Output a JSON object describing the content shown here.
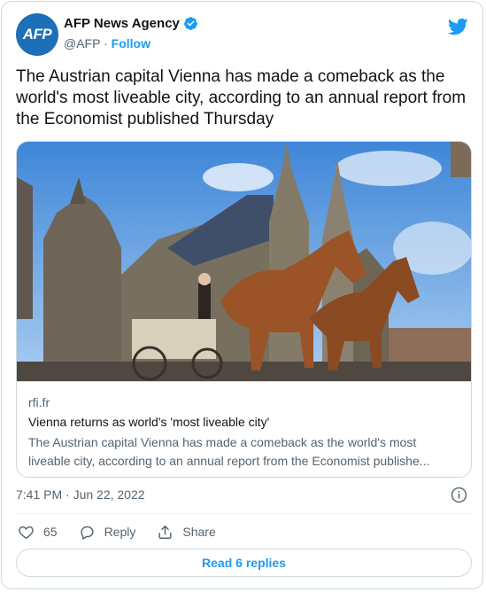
{
  "account": {
    "avatar_text": "AFP",
    "name": "AFP News Agency",
    "handle": "@AFP",
    "separator": "·",
    "follow_label": "Follow"
  },
  "tweet": {
    "text": "The Austrian capital Vienna has made a comeback as the world's most liveable city, according to an annual report from the Economist published Thursday",
    "timestamp": "7:41 PM · Jun 22, 2022"
  },
  "link_card": {
    "domain": "rfi.fr",
    "title": "Vienna returns as world's 'most liveable city'",
    "description": "The Austrian capital Vienna has made a comeback as the world's most liveable city, according to an annual report from the Economist publishe..."
  },
  "actions": {
    "like_count": "65",
    "reply_label": "Reply",
    "share_label": "Share"
  },
  "read_replies_label": "Read 6 replies",
  "colors": {
    "accent": "#1d9bf0",
    "avatar_bg": "#1d6fb8",
    "secondary_text": "#536471",
    "border": "#cfd9de"
  },
  "icons": [
    "verified-badge-icon",
    "twitter-bird-icon",
    "info-icon",
    "heart-icon",
    "reply-bubble-icon",
    "share-icon"
  ]
}
